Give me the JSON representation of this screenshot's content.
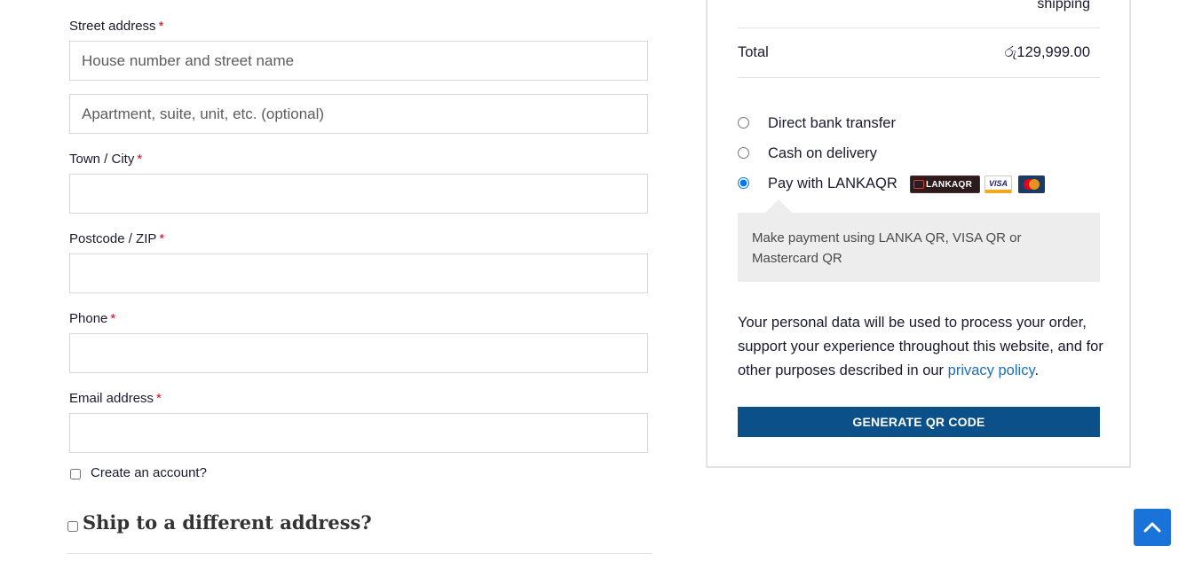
{
  "billing": {
    "street_label": "Street address",
    "street_placeholder": "House number and street name",
    "apartment_placeholder": "Apartment, suite, unit, etc. (optional)",
    "city_label": "Town / City",
    "postcode_label": "Postcode / ZIP",
    "phone_label": "Phone",
    "email_label": "Email address",
    "required_mark": "*",
    "create_account_label": "Create an account?",
    "ship_different_label": "Ship to a different address?"
  },
  "order": {
    "shipping_text": "shipping",
    "total_label": "Total",
    "total_value": "රු129,999.00"
  },
  "payment": {
    "methods": [
      {
        "label": "Direct bank transfer",
        "selected": false
      },
      {
        "label": "Cash on delivery",
        "selected": false
      },
      {
        "label": "Pay with LANKAQR",
        "selected": true
      }
    ],
    "badges": {
      "lankaqr": "LANKAQR",
      "visa": "VISA"
    },
    "description": "Make payment using LANKA QR, VISA QR or Mastercard QR",
    "privacy_text": "Your personal data will be used to process your order, support your experience throughout this website, and for other purposes described in our",
    "privacy_link": "privacy policy",
    "privacy_end": ".",
    "button_label": "GENERATE QR CODE"
  },
  "icons": {
    "scroll_top": "chevron-up-icon"
  },
  "colors": {
    "primary": "#0b5089",
    "accent": "#1a73d9",
    "required": "#e2001a",
    "link": "#1d6fb8"
  }
}
